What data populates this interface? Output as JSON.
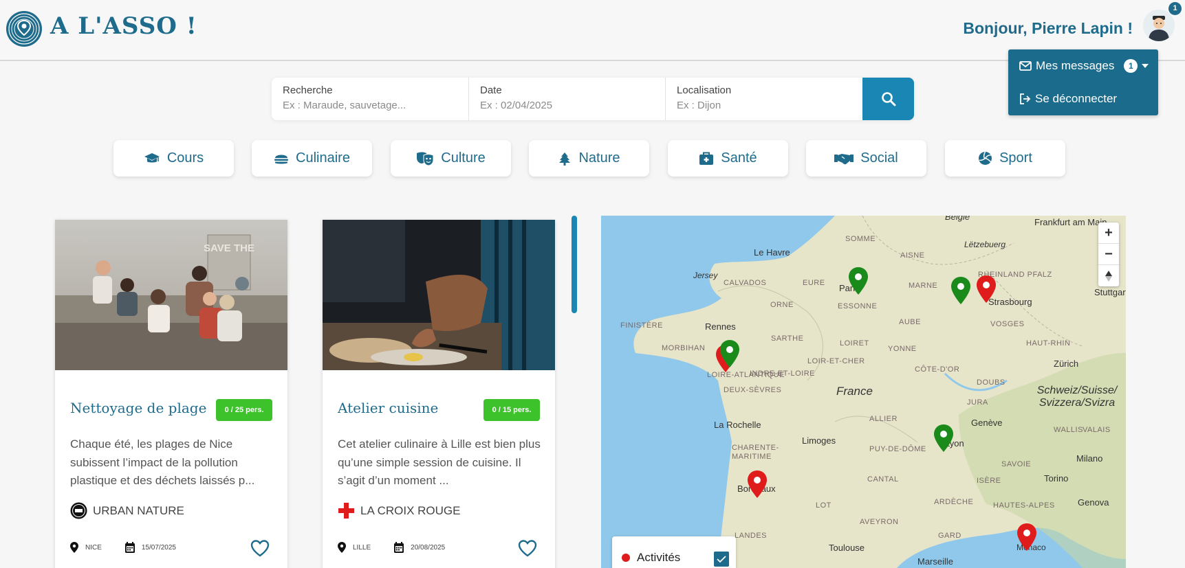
{
  "header": {
    "brand": "A L'ASSO !",
    "greeting": "Bonjour, Pierre Lapin !",
    "notification_count": "1"
  },
  "user_menu": {
    "messages_label": "Mes messages",
    "messages_count": "1",
    "logout_label": "Se déconnecter"
  },
  "search": {
    "query_label": "Recherche",
    "query_placeholder": "Ex : Maraude, sauvetage...",
    "date_label": "Date",
    "date_placeholder": "Ex : 02/04/2025",
    "location_label": "Localisation",
    "location_placeholder": "Ex : Dijon"
  },
  "categories": [
    {
      "label": "Cours",
      "icon": "graduation-cap-icon"
    },
    {
      "label": "Culinaire",
      "icon": "burger-icon"
    },
    {
      "label": "Culture",
      "icon": "masks-icon"
    },
    {
      "label": "Nature",
      "icon": "tree-icon"
    },
    {
      "label": "Santé",
      "icon": "medkit-icon"
    },
    {
      "label": "Social",
      "icon": "handshake-icon"
    },
    {
      "label": "Sport",
      "icon": "volleyball-icon"
    }
  ],
  "cards": [
    {
      "title": "Nettoyage de plage",
      "capacity": "0 / 25 pers.",
      "description": "Chaque été, les plages de Nice subissent l’impact de la pollution plastique et des déchets laissés p...",
      "organization": "URBAN NATURE",
      "city": "NICE",
      "date": "15/07/2025",
      "image_text": "SAVE THE"
    },
    {
      "title": "Atelier cuisine",
      "capacity": "0 / 15 pers.",
      "description": "Cet atelier culinaire à Lille est bien plus qu’une simple session de cuisine. Il s’agit d’un moment ...",
      "organization": "LA CROIX ROUGE",
      "city": "LILLE",
      "date": "20/08/2025"
    }
  ],
  "map": {
    "cities": [
      "Le Havre",
      "Paris",
      "Rennes",
      "Strasbourg",
      "Stuttgart",
      "Frankfurt am Main",
      "Lëtzebuerg",
      "Zürich",
      "Genève",
      "Lyon",
      "Limoges",
      "La Rochelle",
      "Bordeaux",
      "Toulouse",
      "Marseille",
      "Milano",
      "Torino",
      "Genova",
      "Monaco",
      "Jersey",
      "België"
    ],
    "country_labels": [
      "France",
      "Schweiz/Suisse/ Svizzera/Svizra"
    ],
    "regions": [
      "SOMME",
      "AISNE",
      "CALVADOS",
      "EURE",
      "MARNE",
      "ORNE",
      "ESSONNE",
      "FINISTÈRE",
      "MORBIHAN",
      "SARTHE",
      "AUBE",
      "LOIRET",
      "YONNE",
      "VOSGES",
      "RHEINLAND PFALZ",
      "HAUT-RHIN",
      "LOIR-ET-CHER",
      "CÔTE-D'OR",
      "INDRE-ET-LOIRE",
      "DEUX-SÈVRES",
      "DOUBS",
      "JURA",
      "ALLIER",
      "CHARENTE-MARITIME",
      "PUY-DE-DÔME",
      "SAVOIE",
      "ISÈRE",
      "CANTAL",
      "ARDÈCHE",
      "HAUTES-ALPES",
      "LOT",
      "AVEYRON",
      "GARD",
      "LANDES",
      "LOIRE-ATLANTIQUE",
      "WALLIS",
      "VALAIS"
    ],
    "zoom_in": "+",
    "zoom_out": "−",
    "legend_label": "Activités",
    "legend_checked": true,
    "pin_colors": {
      "green": "#1a8a1a",
      "red": "#e01b1b"
    }
  },
  "colors": {
    "primary": "#1f6b8c",
    "accent": "#1a86b3",
    "badge_green": "#3ec22c"
  }
}
